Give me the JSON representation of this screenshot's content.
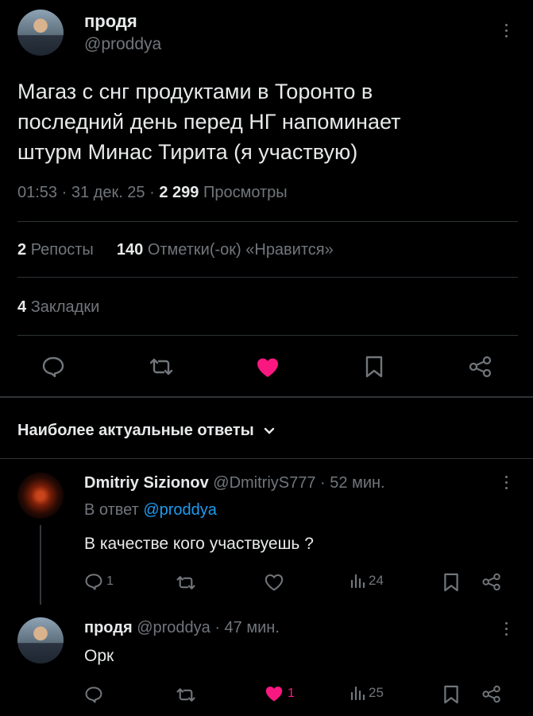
{
  "post": {
    "author_name": "продя",
    "author_handle": "@proddya",
    "text_lines": [
      "Магаз с снг продуктами в Торонто в",
      "последний день перед НГ напоминает",
      "штурм Минас Тирита (я участвую)"
    ],
    "time": "01:53",
    "date": "31 дек. 25",
    "views_count": "2 299",
    "views_label": "Просмотры",
    "reposts_count": "2",
    "reposts_label": "Репосты",
    "likes_count": "140",
    "likes_label": "Отметки(-ок) «Нравится»",
    "bookmarks_count": "4",
    "bookmarks_label": "Закладки",
    "liked_color": "#f91880"
  },
  "replies_header": {
    "label": "Наиболее актуальные ответы"
  },
  "replies": [
    {
      "author_name": "Dmitriy Sizionov",
      "author_handle": "@DmitriyS777",
      "time": "52 мин.",
      "reply_to_prefix": "В ответ",
      "reply_to_handle": "@proddya",
      "text": "В качестве кого участвуешь ?",
      "reply_count": "1",
      "like_count": "",
      "views": "24"
    },
    {
      "author_name": "продя",
      "author_handle": "@proddya",
      "time": "47 мин.",
      "text": "Орк",
      "like_count": "1",
      "views": "25"
    }
  ]
}
